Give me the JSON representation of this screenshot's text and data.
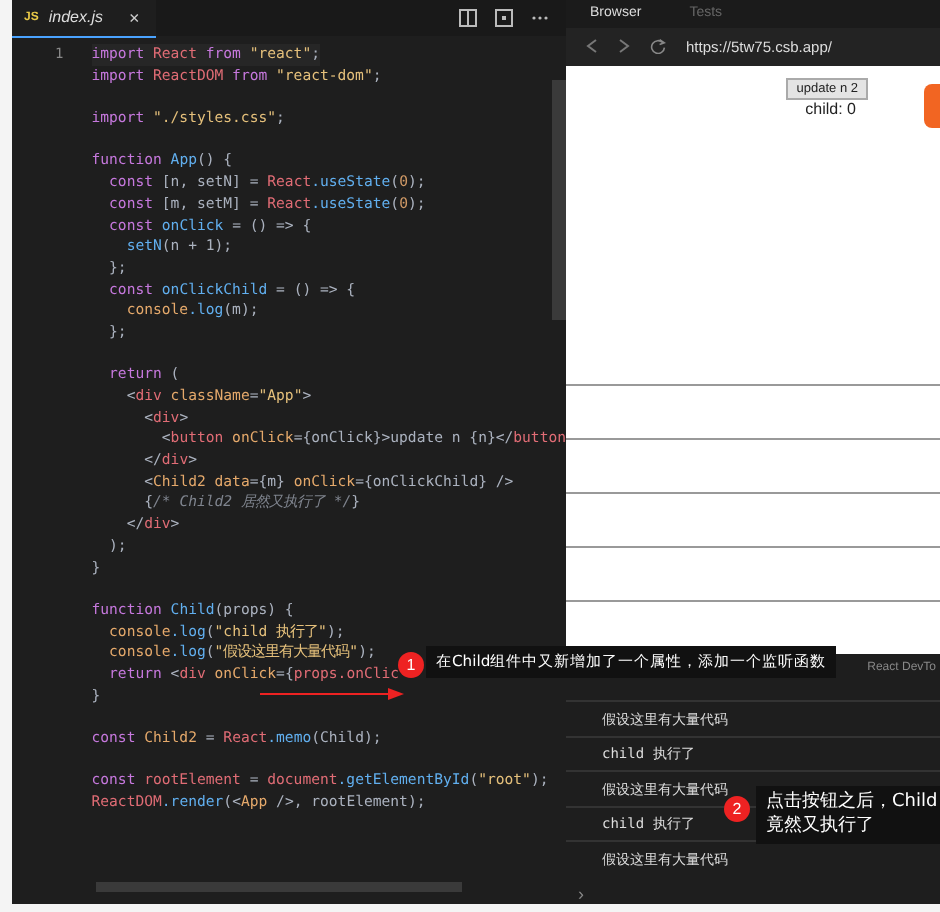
{
  "editor": {
    "tab": {
      "badge": "JS",
      "label": "index.js",
      "close": "×",
      "selected": true
    },
    "active_line_number": "1",
    "lines": [
      {
        "kind": "code",
        "tokens": [
          {
            "kind": "kw",
            "text": "import"
          },
          {
            "kind": "var",
            "text": " React "
          },
          {
            "kind": "kw",
            "text": "from"
          },
          {
            "kind": "str",
            "text": " \"react\""
          },
          {
            "kind": "plain",
            "text": ";"
          }
        ]
      },
      {
        "kind": "code",
        "tokens": [
          {
            "kind": "kw",
            "text": "import"
          },
          {
            "kind": "var",
            "text": " ReactDOM "
          },
          {
            "kind": "kw",
            "text": "from"
          },
          {
            "kind": "str",
            "text": " \"react-dom\""
          },
          {
            "kind": "plain",
            "text": ";"
          }
        ]
      },
      {
        "kind": "blank"
      },
      {
        "kind": "code",
        "tokens": [
          {
            "kind": "kw",
            "text": "import"
          },
          {
            "kind": "str",
            "text": " \"./styles.css\""
          },
          {
            "kind": "plain",
            "text": ";"
          }
        ]
      },
      {
        "kind": "blank"
      },
      {
        "kind": "code",
        "tokens": [
          {
            "kind": "kw",
            "text": "function"
          },
          {
            "kind": "fn",
            "text": " App"
          },
          {
            "kind": "plain",
            "text": "() {"
          }
        ]
      },
      {
        "kind": "code",
        "tokens": [
          {
            "kind": "kw",
            "text": "  const"
          },
          {
            "kind": "plain",
            "text": " [n, setN] = "
          },
          {
            "kind": "var",
            "text": "React"
          },
          {
            "kind": "fn",
            "text": ".useState"
          },
          {
            "kind": "plain",
            "text": "("
          },
          {
            "kind": "num",
            "text": "0"
          },
          {
            "kind": "plain",
            "text": ");"
          }
        ]
      },
      {
        "kind": "code",
        "tokens": [
          {
            "kind": "kw",
            "text": "  const"
          },
          {
            "kind": "plain",
            "text": " [m, setM] = "
          },
          {
            "kind": "var",
            "text": "React"
          },
          {
            "kind": "fn",
            "text": ".useState"
          },
          {
            "kind": "plain",
            "text": "("
          },
          {
            "kind": "num",
            "text": "0"
          },
          {
            "kind": "plain",
            "text": ");"
          }
        ]
      },
      {
        "kind": "code",
        "tokens": [
          {
            "kind": "kw",
            "text": "  const"
          },
          {
            "kind": "fn",
            "text": " onClick"
          },
          {
            "kind": "plain",
            "text": " = () => {"
          }
        ]
      },
      {
        "kind": "code",
        "tokens": [
          {
            "kind": "fn",
            "text": "    setN"
          },
          {
            "kind": "plain",
            "text": "(n + 1);"
          }
        ]
      },
      {
        "kind": "code",
        "tokens": [
          {
            "kind": "plain",
            "text": "  };"
          }
        ]
      },
      {
        "kind": "code",
        "tokens": [
          {
            "kind": "kw",
            "text": "  const"
          },
          {
            "kind": "fn",
            "text": " onClickChild"
          },
          {
            "kind": "plain",
            "text": " = () => {"
          }
        ]
      },
      {
        "kind": "code",
        "tokens": [
          {
            "kind": "attr",
            "text": "    console"
          },
          {
            "kind": "fn",
            "text": ".log"
          },
          {
            "kind": "plain",
            "text": "(m);"
          }
        ]
      },
      {
        "kind": "code",
        "tokens": [
          {
            "kind": "plain",
            "text": "  };"
          }
        ]
      },
      {
        "kind": "blank"
      },
      {
        "kind": "code",
        "tokens": [
          {
            "kind": "kw",
            "text": "  return"
          },
          {
            "kind": "plain",
            "text": " ("
          }
        ]
      },
      {
        "kind": "code",
        "tokens": [
          {
            "kind": "plain",
            "text": "    <"
          },
          {
            "kind": "tag",
            "text": "div"
          },
          {
            "kind": "attr",
            "text": " className"
          },
          {
            "kind": "plain",
            "text": "="
          },
          {
            "kind": "str",
            "text": "\"App\""
          },
          {
            "kind": "plain",
            "text": ">"
          }
        ]
      },
      {
        "kind": "code",
        "tokens": [
          {
            "kind": "plain",
            "text": "      <"
          },
          {
            "kind": "tag",
            "text": "div"
          },
          {
            "kind": "plain",
            "text": ">"
          }
        ]
      },
      {
        "kind": "code",
        "tokens": [
          {
            "kind": "plain",
            "text": "        <"
          },
          {
            "kind": "tag",
            "text": "button"
          },
          {
            "kind": "attr",
            "text": " onClick"
          },
          {
            "kind": "plain",
            "text": "={onClick}>update n {n}</"
          },
          {
            "kind": "tag",
            "text": "button"
          }
        ]
      },
      {
        "kind": "code",
        "tokens": [
          {
            "kind": "plain",
            "text": "      </"
          },
          {
            "kind": "tag",
            "text": "div"
          },
          {
            "kind": "plain",
            "text": ">"
          }
        ]
      },
      {
        "kind": "code",
        "tokens": [
          {
            "kind": "plain",
            "text": "      <"
          },
          {
            "kind": "attr",
            "text": "Child2"
          },
          {
            "kind": "attr",
            "text": " data"
          },
          {
            "kind": "plain",
            "text": "={m}"
          },
          {
            "kind": "attr",
            "text": " onClick"
          },
          {
            "kind": "plain",
            "text": "={onClickChild} />"
          }
        ]
      },
      {
        "kind": "code",
        "tokens": [
          {
            "kind": "plain",
            "text": "      {"
          },
          {
            "kind": "comment",
            "text": "/* Child2 居然又执行了 */"
          },
          {
            "kind": "plain",
            "text": "}"
          }
        ]
      },
      {
        "kind": "code",
        "tokens": [
          {
            "kind": "plain",
            "text": "    </"
          },
          {
            "kind": "tag",
            "text": "div"
          },
          {
            "kind": "plain",
            "text": ">"
          }
        ]
      },
      {
        "kind": "code",
        "tokens": [
          {
            "kind": "plain",
            "text": "  );"
          }
        ]
      },
      {
        "kind": "code",
        "tokens": [
          {
            "kind": "plain",
            "text": "}"
          }
        ]
      },
      {
        "kind": "blank"
      },
      {
        "kind": "code",
        "tokens": [
          {
            "kind": "kw",
            "text": "function"
          },
          {
            "kind": "fn",
            "text": " Child"
          },
          {
            "kind": "plain",
            "text": "(props) {"
          }
        ]
      },
      {
        "kind": "code",
        "tokens": [
          {
            "kind": "attr",
            "text": "  console"
          },
          {
            "kind": "fn",
            "text": ".log"
          },
          {
            "kind": "plain",
            "text": "("
          },
          {
            "kind": "str",
            "text": "\"child 执行了\""
          },
          {
            "kind": "plain",
            "text": ");"
          }
        ]
      },
      {
        "kind": "code",
        "tokens": [
          {
            "kind": "attr",
            "text": "  console"
          },
          {
            "kind": "fn",
            "text": ".log"
          },
          {
            "kind": "plain",
            "text": "("
          },
          {
            "kind": "str",
            "text": "\"假设这里有大量代码\""
          },
          {
            "kind": "plain",
            "text": ");"
          }
        ]
      },
      {
        "kind": "code",
        "tokens": [
          {
            "kind": "kw",
            "text": "  return"
          },
          {
            "kind": "plain",
            "text": " <"
          },
          {
            "kind": "tag",
            "text": "div"
          },
          {
            "kind": "attr",
            "text": " onClick"
          },
          {
            "kind": "plain",
            "text": "={"
          },
          {
            "kind": "var",
            "text": "props.onClic"
          }
        ]
      },
      {
        "kind": "code",
        "tokens": [
          {
            "kind": "plain",
            "text": "}"
          }
        ]
      },
      {
        "kind": "blank"
      },
      {
        "kind": "code",
        "tokens": [
          {
            "kind": "kw",
            "text": "const"
          },
          {
            "kind": "attr",
            "text": " Child2"
          },
          {
            "kind": "plain",
            "text": " = "
          },
          {
            "kind": "var",
            "text": "React"
          },
          {
            "kind": "fn",
            "text": ".memo"
          },
          {
            "kind": "plain",
            "text": "(Child);"
          }
        ]
      },
      {
        "kind": "blank"
      },
      {
        "kind": "code",
        "tokens": [
          {
            "kind": "kw",
            "text": "const"
          },
          {
            "kind": "var",
            "text": " rootElement"
          },
          {
            "kind": "plain",
            "text": " = "
          },
          {
            "kind": "var",
            "text": "document"
          },
          {
            "kind": "fn",
            "text": ".getElementById"
          },
          {
            "kind": "plain",
            "text": "("
          },
          {
            "kind": "str",
            "text": "\"root\""
          },
          {
            "kind": "plain",
            "text": ");"
          }
        ]
      },
      {
        "kind": "code",
        "tokens": [
          {
            "kind": "var",
            "text": "ReactDOM"
          },
          {
            "kind": "fn",
            "text": ".render"
          },
          {
            "kind": "plain",
            "text": "(<"
          },
          {
            "kind": "attr",
            "text": "App"
          },
          {
            "kind": "plain",
            "text": " />, rootElement);"
          }
        ]
      }
    ]
  },
  "browser": {
    "tabs": [
      {
        "label": "Browser",
        "selected": true
      },
      {
        "label": "Tests",
        "selected": false
      }
    ],
    "url": "https://5tw75.csb.app/",
    "preview": {
      "button": "update n 2",
      "text": "child: 0"
    }
  },
  "console": {
    "tab": "React DevTo",
    "messages": [
      {
        "kind": "cjk",
        "text": "假设这里有大量代码"
      },
      {
        "kind": "mono",
        "text": "child 执行了"
      },
      {
        "kind": "cjk",
        "text": "假设这里有大量代码"
      },
      {
        "kind": "mono",
        "text": "child 执行了"
      },
      {
        "kind": "cjk",
        "text": "假设这里有大量代码"
      }
    ],
    "prompt": "›"
  },
  "annotations": [
    {
      "number": "1",
      "text": "在Child组件中又新增加了一个属性，添加一个监听函数"
    },
    {
      "number": "2",
      "text": "点击按钮之后，Child竟然又执行了"
    }
  ]
}
